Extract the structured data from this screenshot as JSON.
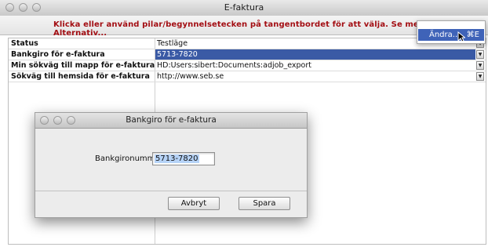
{
  "window": {
    "title": "E-faktura"
  },
  "hint": "Klicka eller använd pilar/begynnelsetecken på tangentbordet för att välja. Se menyn Alternativ...",
  "rows": [
    {
      "key": "Status",
      "value": "Testläge"
    },
    {
      "key": "Bankgiro för e-faktura",
      "value": "5713-7820"
    },
    {
      "key": "Min sökväg till mapp för e-faktura",
      "value": "HD:Users:sibert:Documents:adjob_export"
    },
    {
      "key": "Sökväg till hemsida för e-faktura",
      "value": "http://www.seb.se"
    }
  ],
  "menu": {
    "item": "Ändra...",
    "shortcut": "⌘E"
  },
  "dialog": {
    "title": "Bankgiro för e-faktura",
    "label": "Bankgironummer",
    "value": "5713-7820",
    "cancel": "Avbryt",
    "save": "Spara"
  }
}
